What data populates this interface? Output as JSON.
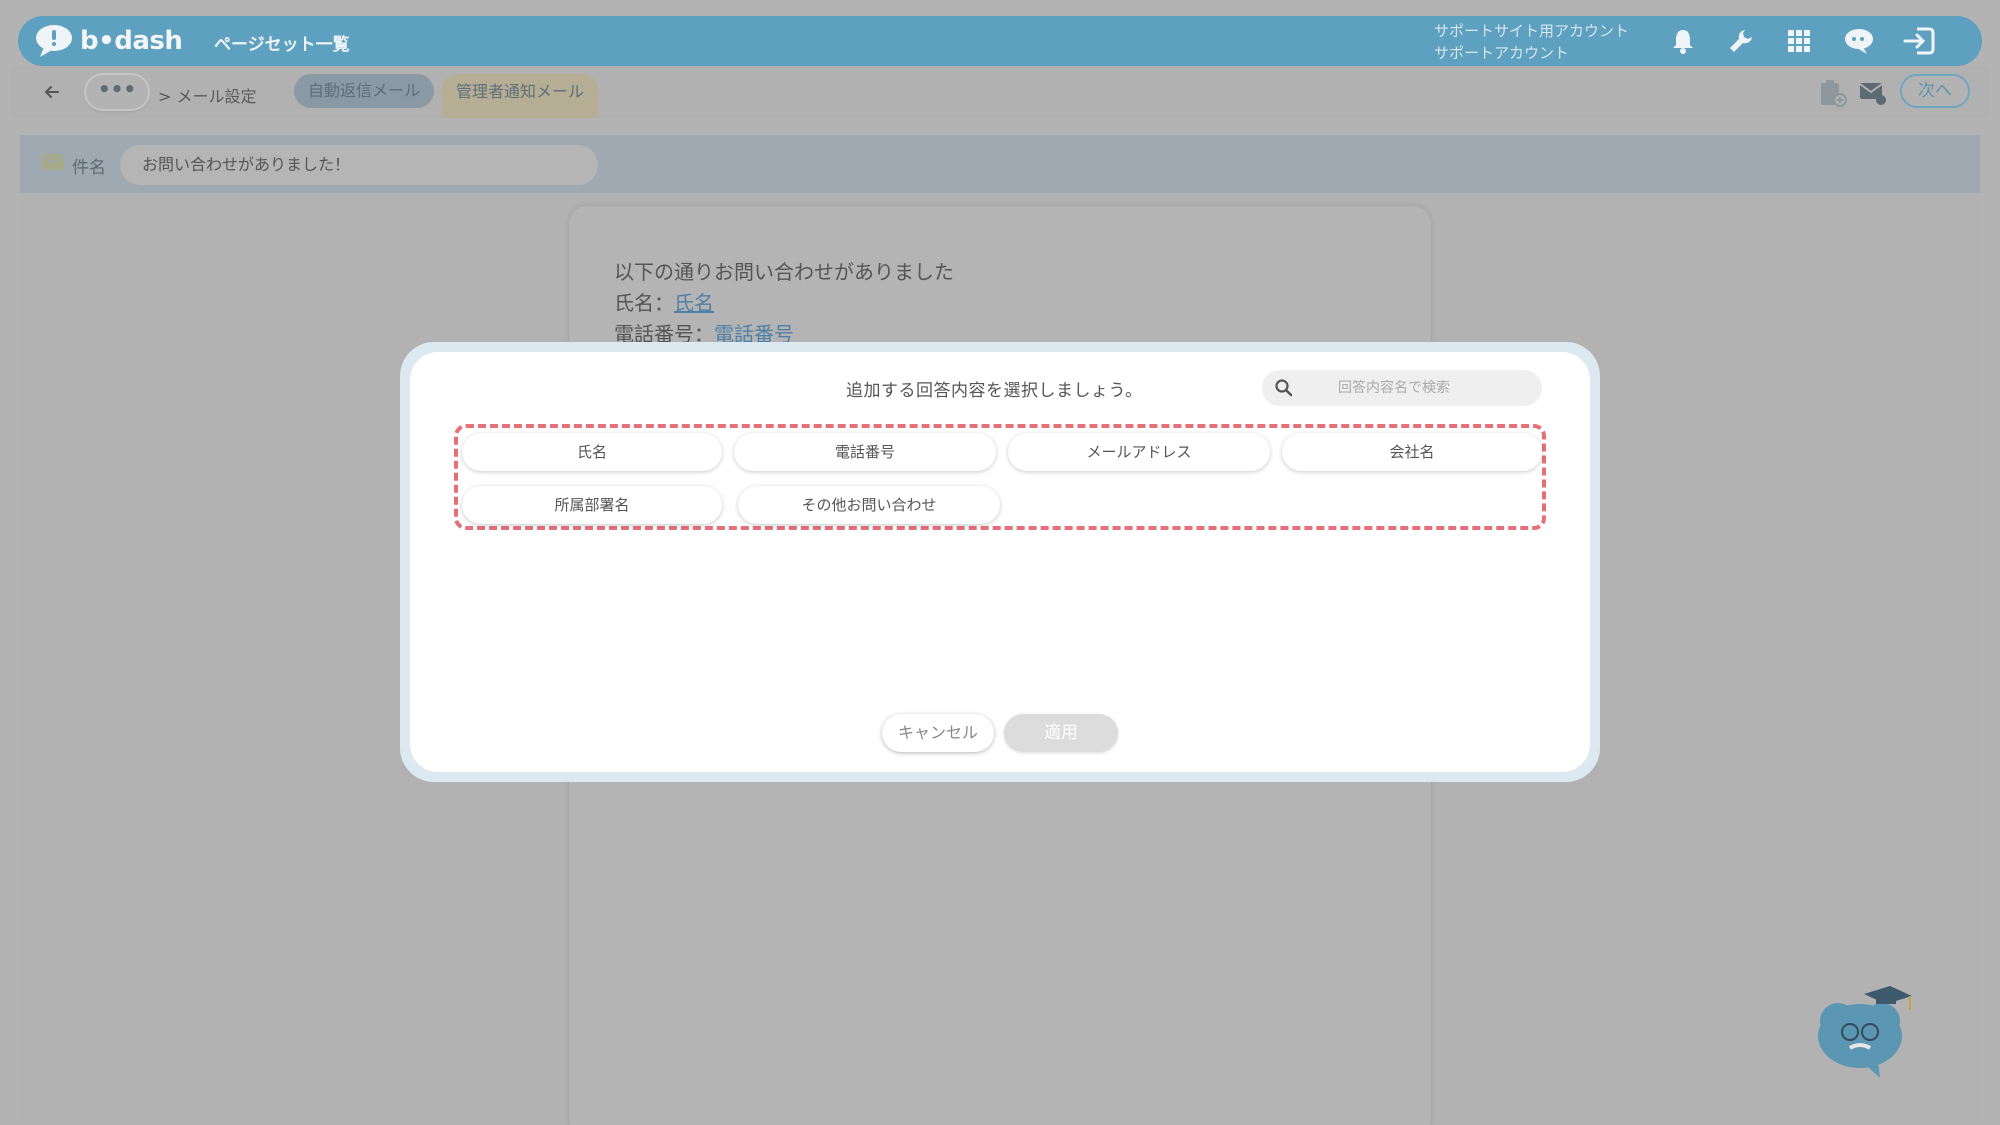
{
  "header": {
    "logo_text": "b•dash",
    "app_title": "ページセット一覧",
    "account_line1": "サポートサイト用アカウント",
    "account_line2": "サポートアカウント",
    "icons": [
      "bell-icon",
      "wrench-icon",
      "grid-icon",
      "chat-icon",
      "logout-icon"
    ]
  },
  "nav": {
    "more_label": "•••",
    "breadcrumb": "> メール設定",
    "tabs": [
      {
        "label": "自動返信メール",
        "active": false
      },
      {
        "label": "管理者通知メール",
        "active": true
      }
    ],
    "next_label": "次へ"
  },
  "subject": {
    "label": "件名",
    "value": "お問い合わせがありました！"
  },
  "editor": {
    "line1": "以下の通りお問い合わせがありました",
    "line2_prefix": "氏名：",
    "line2_tag": "氏名",
    "line3_prefix": "電話番号：",
    "line3_tag": "電話番号"
  },
  "modal": {
    "title": "追加する回答内容を選択しましょう。",
    "search_placeholder": "回答内容名で検索",
    "search_value": "",
    "options": [
      "氏名",
      "電話番号",
      "メールアドレス",
      "会社名",
      "所属部署名",
      "その他お問い合わせ"
    ],
    "cancel_label": "キャンセル",
    "apply_label": "適用"
  },
  "colors": {
    "header_bg": "#5da0bf",
    "highlight_dash": "#e5707a",
    "overlay_bg": "#b3b3b3"
  }
}
